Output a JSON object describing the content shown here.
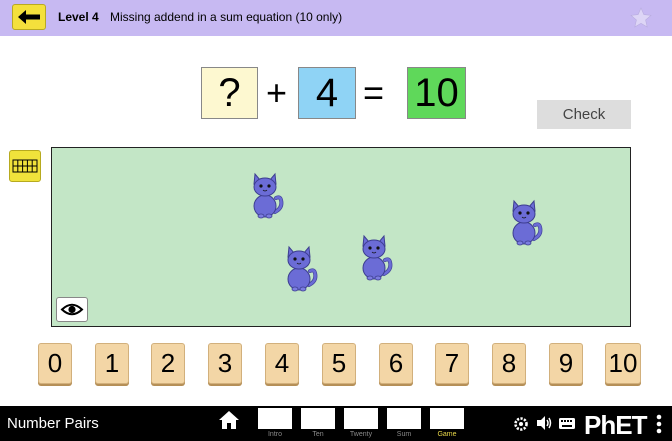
{
  "header": {
    "level_title": "Level 4",
    "level_description": "Missing addend in a sum equation (10 only)"
  },
  "equation": {
    "addend_a": "?",
    "plus": "+",
    "addend_b": "4",
    "equals": "=",
    "sum": "10"
  },
  "check_label": "Check",
  "number_buttons": [
    "0",
    "1",
    "2",
    "3",
    "4",
    "5",
    "6",
    "7",
    "8",
    "9",
    "10"
  ],
  "navbar": {
    "app_title": "Number Pairs",
    "screens": [
      {
        "label": "Intro",
        "active": false
      },
      {
        "label": "Ten",
        "active": false
      },
      {
        "label": "Twenty",
        "active": false
      },
      {
        "label": "Sum",
        "active": false
      },
      {
        "label": "Game",
        "active": true
      }
    ],
    "logo": "PhET"
  },
  "colors": {
    "header_bg": "#c7b9f2",
    "unknown_box": "#fdf8d0",
    "addend_box": "#8fd3f5",
    "sum_box": "#5fd85a",
    "play_area": "#c3e6c6",
    "number_button": "#f3d6a6",
    "cat": "#6b6cd6"
  },
  "icons": [
    "back-arrow-icon",
    "star-icon",
    "ten-frame-icon",
    "eye-icon",
    "cat-icon",
    "home-icon",
    "settings-icon",
    "sound-icon",
    "keyboard-icon"
  ]
}
